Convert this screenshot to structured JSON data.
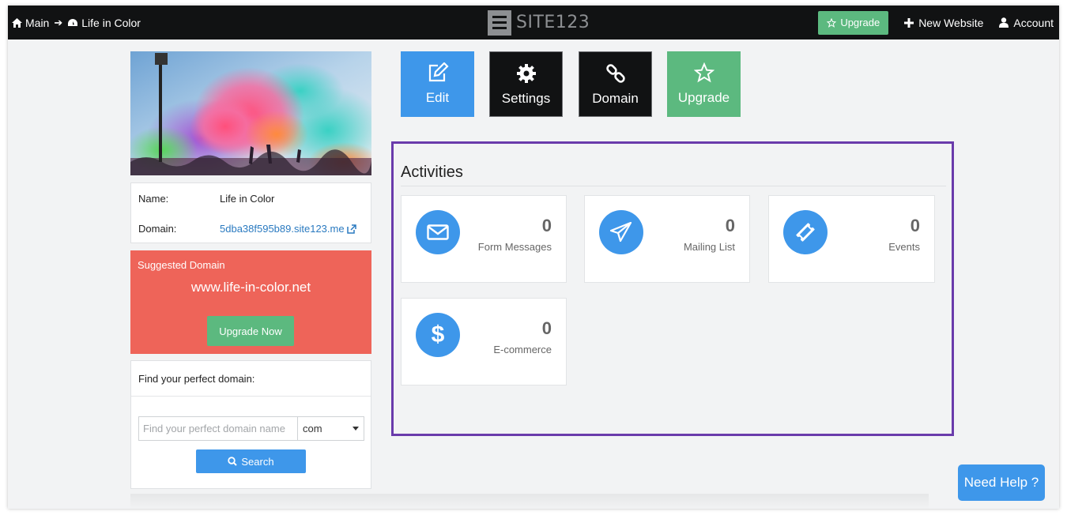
{
  "topbar": {
    "crumbs": [
      {
        "label": "Main",
        "icon": "home-icon"
      },
      {
        "label": "Life in Color",
        "icon": "dashboard-icon"
      }
    ],
    "logo_text": "SITE123",
    "upgrade_label": "Upgrade",
    "new_website_label": "New Website",
    "account_label": "Account"
  },
  "site": {
    "name_label": "Name:",
    "name_value": "Life in Color",
    "domain_label": "Domain:",
    "domain_value": "5dba38f595b89.site123.me"
  },
  "suggested": {
    "title": "Suggested Domain",
    "domain": "www.life-in-color.net",
    "button": "Upgrade Now"
  },
  "finder": {
    "heading": "Find your perfect domain:",
    "placeholder": "Find your perfect domain name",
    "tld_selected": "com",
    "search_label": "Search"
  },
  "actions": [
    {
      "label": "Edit",
      "icon": "edit-icon"
    },
    {
      "label": "Settings",
      "icon": "gear-icon"
    },
    {
      "label": "Domain",
      "icon": "link-icon"
    },
    {
      "label": "Upgrade",
      "icon": "star-icon"
    }
  ],
  "activities": {
    "title": "Activities",
    "cards": [
      {
        "count": "0",
        "caption": "Form Messages",
        "icon": "envelope-icon"
      },
      {
        "count": "0",
        "caption": "Mailing List",
        "icon": "paper-plane-icon"
      },
      {
        "count": "0",
        "caption": "Events",
        "icon": "ticket-icon"
      },
      {
        "count": "0",
        "caption": "E-commerce",
        "icon": "dollar-icon"
      }
    ]
  },
  "help_label": "Need Help ?",
  "colors": {
    "topbar": "#111213",
    "blue": "#3e97ea",
    "green": "#5cb97f",
    "coral": "#ee6459",
    "highlight": "#6a3bab"
  }
}
